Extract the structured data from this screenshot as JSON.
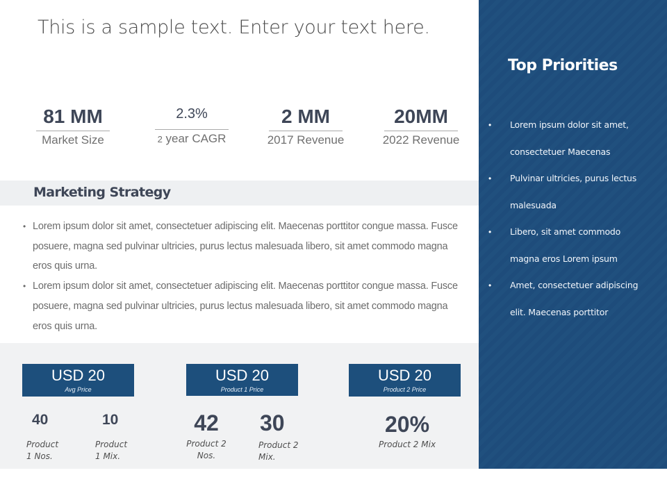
{
  "slide": {
    "title": "This is a sample text. Enter your text here."
  },
  "kpis": [
    {
      "value": "81 MM",
      "label": "Market Size"
    },
    {
      "value": "2.3%",
      "label_prefix": "2",
      "label": " year CAGR"
    },
    {
      "value": "2 MM",
      "label": "2017 Revenue"
    },
    {
      "value": "20MM",
      "label": "2022 Revenue"
    }
  ],
  "marketing_strategy": {
    "title": "Marketing Strategy",
    "bullet_glyph": "•",
    "items": [
      "Lorem ipsum dolor sit amet, consectetuer adipiscing elit. Maecenas porttitor congue massa. Fusce posuere, magna sed pulvinar ultricies, purus lectus malesuada libero, sit amet commodo magna eros quis urna.",
      "Lorem ipsum dolor sit amet, consectetuer adipiscing elit. Maecenas porttitor congue massa. Fusce posuere, magna sed pulvinar ultricies, purus lectus malesuada libero, sit amet commodo magna eros quis urna."
    ]
  },
  "pricing": {
    "boxes": [
      {
        "amount": "USD 20",
        "caption": "Avg Price"
      },
      {
        "amount": "USD 20",
        "caption": "Product 1 Price"
      },
      {
        "amount": "USD 20",
        "caption": "Product 2 Price"
      }
    ],
    "metrics": [
      {
        "value": "40",
        "line1": "Product",
        "line2": "1 Nos."
      },
      {
        "value": "10",
        "line1": "Product",
        "line2": "1 Mix."
      },
      {
        "value": "42",
        "line1": "Product 2",
        "line2": "Nos."
      },
      {
        "value": "30",
        "line1": "Product 2",
        "line2": "Mix."
      },
      {
        "value": "20%",
        "line1": "Product 2 Mix",
        "line2": ""
      }
    ]
  },
  "top_priorities": {
    "title": "Top Priorities",
    "bullet_glyph": "•",
    "items": [
      {
        "line1": "Lorem ipsum dolor sit amet,",
        "line2": "consectetuer Maecenas"
      },
      {
        "line1": "Pulvinar ultricies, purus lectus",
        "line2": "malesuada"
      },
      {
        "line1": "Libero, sit amet commodo",
        "line2": "magna eros Lorem ipsum"
      },
      {
        "line1": "Amet, consectetuer adipiscing",
        "line2": "elit. Maecenas porttitor"
      }
    ]
  },
  "colors": {
    "accent_navy": "#1d4f7c",
    "text_dark": "#3e4657",
    "text_muted": "#707070",
    "panel_gray": "#f1f2f3"
  }
}
